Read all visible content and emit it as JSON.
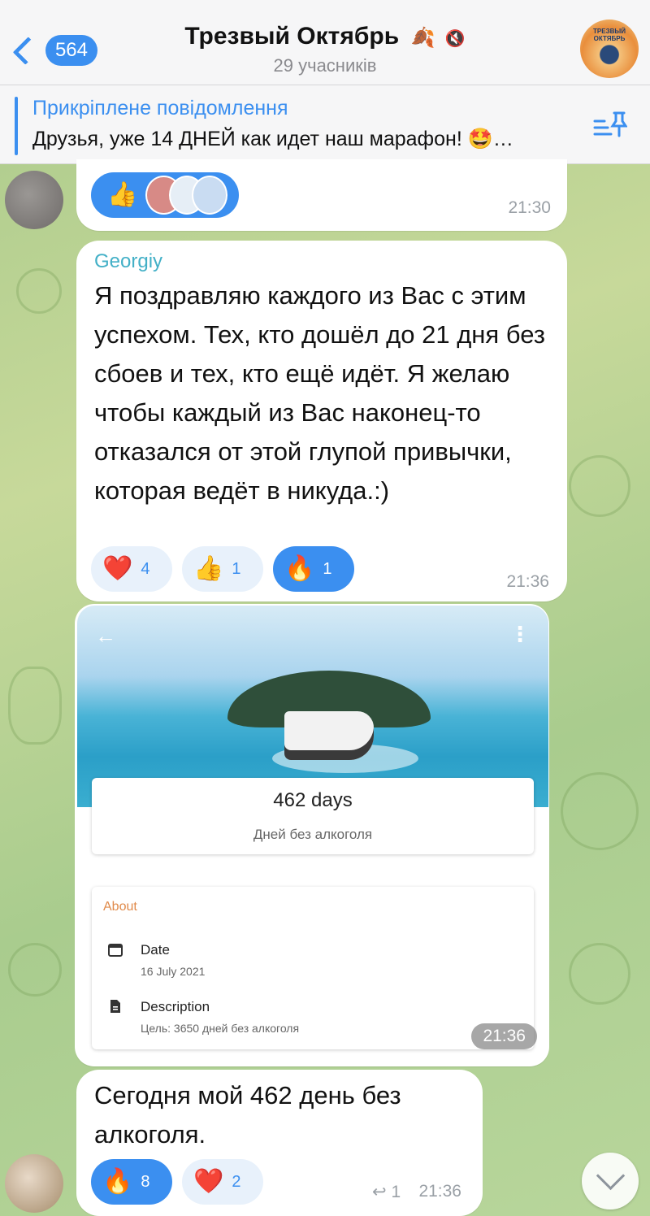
{
  "header": {
    "back_count": "564",
    "title": "Трезвый Октябрь",
    "title_emoji": "🍂",
    "subtitle": "29 учасників",
    "avatar_text": "ТРЕЗВЫЙ ОКТЯБРЬ"
  },
  "pinned": {
    "title": "Прикріплене повідомлення",
    "text": "Друзья, уже 14 ДНЕЙ как идет наш марафон! 🤩…"
  },
  "messages": {
    "m1": {
      "time": "21:30",
      "reaction_emoji": "👍"
    },
    "m2": {
      "sender": "Georgiy",
      "text": "Я поздравляю каждого из Вас с этим успехом. Тех, кто дошёл до 21 дня без сбоев и тех, кто ещё идёт. Я желаю чтобы каждый из Вас наконец-то отказался от этой глупой привычки, которая ведёт в никуда.:)",
      "time": "21:36",
      "reactions": [
        {
          "emoji": "❤️",
          "count": "4"
        },
        {
          "emoji": "👍",
          "count": "1"
        },
        {
          "emoji": "🔥",
          "count": "1"
        }
      ]
    },
    "m3": {
      "time": "21:36",
      "app": {
        "days_value": "462 days",
        "days_caption": "Дней без алкоголя",
        "about_title": "About",
        "date_title": "Date",
        "date_value": "16 July 2021",
        "desc_title": "Description",
        "desc_value": "Цель: 3650 дней без алкоголя"
      }
    },
    "m4": {
      "text": "Сегодня мой 462 день без алкоголя.",
      "time": "21:36",
      "reply_count": "1",
      "reactions": [
        {
          "emoji": "🔥",
          "count": "8"
        },
        {
          "emoji": "❤️",
          "count": "2"
        }
      ]
    }
  }
}
